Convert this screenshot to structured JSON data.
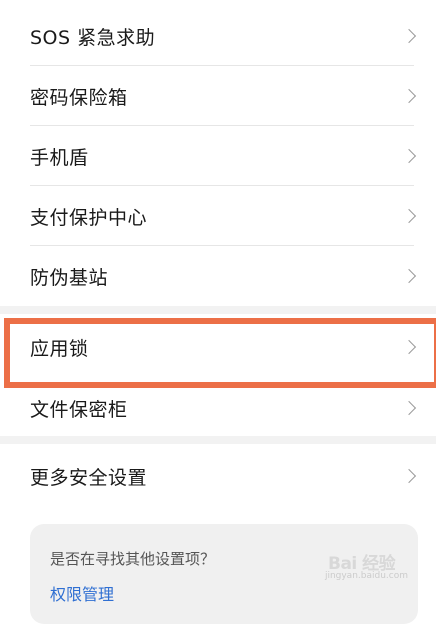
{
  "security_list_top": [
    {
      "label": "SOS 紧急求助"
    },
    {
      "label": "密码保险箱"
    },
    {
      "label": "手机盾"
    },
    {
      "label": "支付保护中心"
    },
    {
      "label": "防伪基站"
    }
  ],
  "security_list_middle": [
    {
      "label": "应用锁"
    },
    {
      "label": "文件保密柜"
    }
  ],
  "security_list_bottom": [
    {
      "label": "更多安全设置"
    }
  ],
  "hint_card": {
    "question": "是否在寻找其他设置项？",
    "link": "权限管理"
  },
  "watermark": {
    "text": "Bai 经验",
    "subtext": "jingyan.baidu.com"
  },
  "colors": {
    "highlight": "#ec6f47",
    "link": "#2f6fd2"
  }
}
